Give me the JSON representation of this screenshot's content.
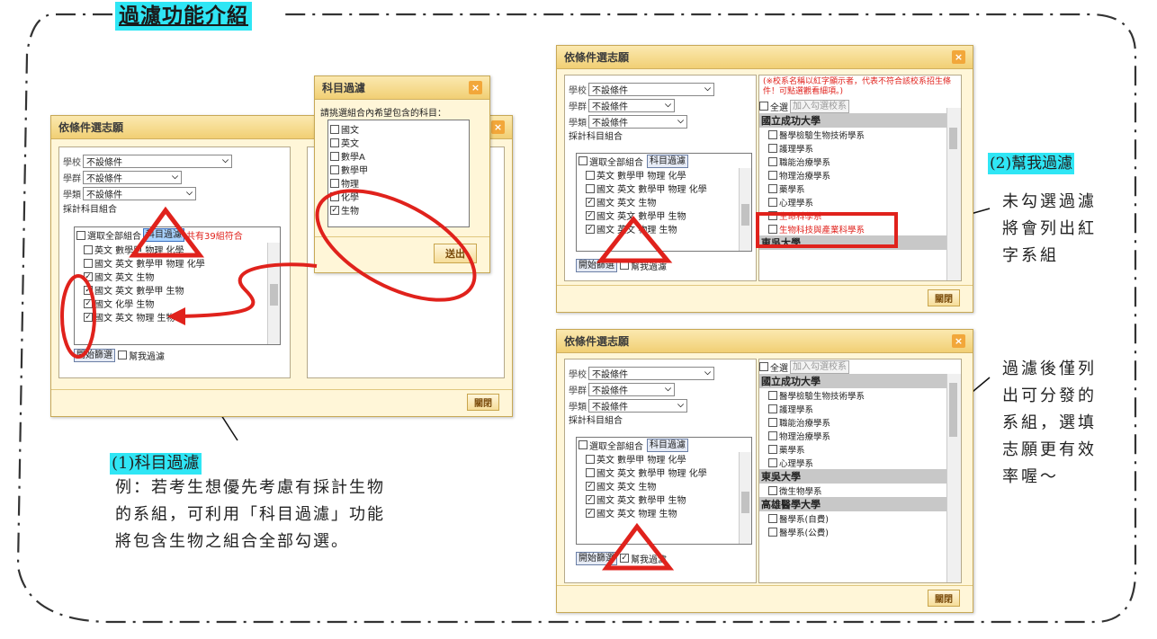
{
  "page_title": "過濾功能介紹",
  "dialog": {
    "title": "依條件選志願",
    "close_label": "關閉",
    "school_label": "學校",
    "group_label": "學群",
    "class_label": "學類",
    "no_condition": "不設條件",
    "subjects_label": "採計科目組合",
    "select_all": "選取全部組合",
    "subject_filter_btn": "科目過濾",
    "match_text": "共有39組符合",
    "start_btn": "開始篩選",
    "help_filter": "幫我過濾",
    "combos": [
      {
        "text": "英文 數學甲 物理 化學",
        "checked": false
      },
      {
        "text": "國文 英文 數學甲 物理 化學",
        "checked": false
      },
      {
        "text": "國文 英文 生物",
        "checked": true
      },
      {
        "text": "國文 英文 數學甲 生物",
        "checked": true
      },
      {
        "text": "國文 化學 生物",
        "checked": true
      },
      {
        "text": "國文 英文 物理 生物",
        "checked": true
      }
    ],
    "combos_b": [
      {
        "text": "英文 數學甲 物理 化學",
        "checked": false
      },
      {
        "text": "國文 英文 數學甲 物理 化學",
        "checked": false
      },
      {
        "text": "國文 英文 生物",
        "checked": true
      },
      {
        "text": "國文 英文 數學甲 生物",
        "checked": true
      },
      {
        "text": "國文 英文 物理 生物",
        "checked": true
      }
    ]
  },
  "subject_dialog": {
    "title": "科目過濾",
    "prompt": "請挑選組合內希望包含的科目：",
    "subjects": [
      {
        "name": "國文",
        "checked": false
      },
      {
        "name": "英文",
        "checked": false
      },
      {
        "name": "數學A",
        "checked": false
      },
      {
        "name": "數學甲",
        "checked": false
      },
      {
        "name": "物理",
        "checked": false
      },
      {
        "name": "化學",
        "checked": false
      },
      {
        "name": "生物",
        "checked": true
      }
    ],
    "submit": "送出"
  },
  "results": {
    "notice": "(※校系名稱以紅字顯示者，代表不符合該校系招生條件！可點選觀看細項。)",
    "select_all": "全選",
    "add_btn": "加入勾選校系",
    "school1": "國立成功大學",
    "school2": "東吳大學",
    "school3": "高雄醫學大學",
    "depts_top": [
      "醫學檢驗生物技術學系",
      "護理學系",
      "職能治療學系",
      "物理治療學系",
      "藥學系",
      "心理學系"
    ],
    "depts_red": [
      "生命科學系",
      "生物科技與產業科學系"
    ],
    "depts_bottom_ncku": [
      "醫學檢驗生物技術學系",
      "護理學系",
      "職能治療學系",
      "物理治療學系",
      "藥學系",
      "心理學系"
    ],
    "dept_scu": "微生物學系",
    "depts_kmu": [
      "醫學系(自費)",
      "醫學系(公費)"
    ]
  },
  "notes": {
    "note1_title": "(1)科目過濾",
    "note1_lines": [
      "例：若考生想優先考慮有採計生物",
      "的系組，可利用「科目過濾」功能",
      "將包含生物之組合全部勾選。"
    ],
    "note2_title": "(2)幫我過濾",
    "note2_lines": [
      "未勾選過濾",
      "將會列出紅",
      "字系組"
    ],
    "note3_lines": [
      "過濾後僅列",
      "出可分發的",
      "系組，選填",
      "志願更有效",
      "率喔～"
    ]
  },
  "colors": {
    "highlight": "#2fe6f5",
    "annotation_red": "#e0221c",
    "dialog_bg": "#fff6d8"
  }
}
